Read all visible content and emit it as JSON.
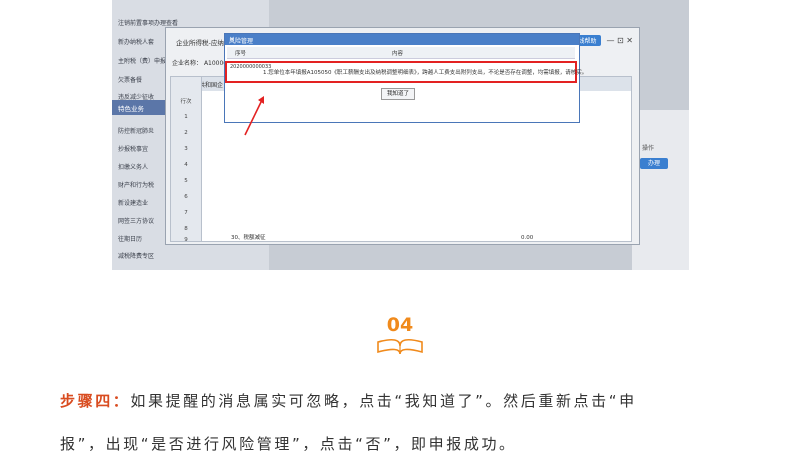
{
  "sidebar": {
    "items": [
      "注销前置事项办理查看",
      "新办纳税人套",
      "主附税（费）申报",
      "欠票备餐",
      "违反减少征收",
      "防控新冠肺炎",
      "抄报税事宜",
      "扣缴义务人",
      "财产和行为税",
      "新设建造业",
      "网签三方协议",
      "往期日历",
      "减税降费专区"
    ],
    "highlight": "特色业务"
  },
  "dialog": {
    "title": "企业所得税-应纳税所得额",
    "online_help": "在线帮助",
    "controls": "— ⊡ ✕",
    "field_label": "企业名称",
    "field_value": "A100000",
    "table_head": "中华人民共和国企",
    "row_header_label": "行次",
    "row_numbers": [
      "1",
      "2",
      "3",
      "4",
      "5",
      "6",
      "7",
      "8",
      "9"
    ],
    "bottom_label": "30、税额减征",
    "bottom_value": "0.00"
  },
  "background": {
    "operation_label": "操作",
    "action_button": "办理"
  },
  "modal": {
    "title": "风险管理",
    "close": "×",
    "col_seq": "序号",
    "col_content": "内容",
    "row_id": "2020000000033",
    "row_text": "1.您单位本年填报A105050《职工薪酬支出及纳税调整明细表》，跨越人工费支出附列支出，不论是否存在调整，均需填报，请核实。",
    "button": "我知道了"
  },
  "step": {
    "number": "04",
    "label_bold": "步骤四：",
    "line1": "如果提醒的消息属实可忽略，点击“我知道了”。然后重新点击“申",
    "line2": "报”，出现“是否进行风险管理”，点击“否”，即申报成功。"
  }
}
